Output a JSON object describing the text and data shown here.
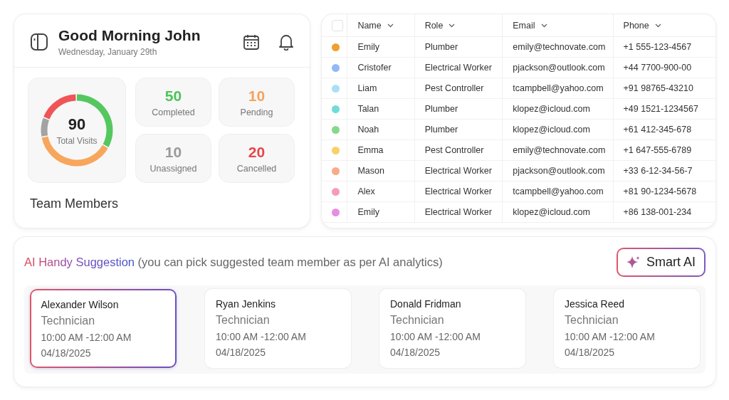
{
  "header": {
    "greeting": "Good Morning John",
    "date": "Wednesday, January 29th"
  },
  "total": {
    "value": "90",
    "label": "Total Visits"
  },
  "stats": [
    {
      "value": "50",
      "label": "Completed",
      "color": "#4cc35a"
    },
    {
      "value": "10",
      "label": "Pending",
      "color": "#f5a35c"
    },
    {
      "value": "10",
      "label": "Unassigned",
      "color": "#9a9a9a"
    },
    {
      "value": "20",
      "label": "Cancelled",
      "color": "#e5484d"
    }
  ],
  "section_title": "Team Members",
  "table": {
    "select_all_checked": false,
    "columns": [
      "Name",
      "Role",
      "Email",
      "Phone"
    ],
    "rows": [
      {
        "color": "#f0a030",
        "cells": [
          "Emily",
          "Plumber",
          "emily@technovate.com",
          "+1 555-123-4567"
        ]
      },
      {
        "color": "#93b8f5",
        "cells": [
          "Cristofer",
          "Electrical Worker",
          "pjackson@outlook.com",
          "+44 7700-900-00"
        ]
      },
      {
        "color": "#a8e0f5",
        "cells": [
          "Liam",
          "Pest Controller",
          "tcampbell@yahoo.com",
          "+91 98765-43210"
        ]
      },
      {
        "color": "#6fdcd8",
        "cells": [
          "Talan",
          "Plumber",
          "klopez@icloud.com",
          "+49 1521-1234567"
        ]
      },
      {
        "color": "#88d88a",
        "cells": [
          "Noah",
          "Plumber",
          "klopez@icloud.com",
          "+61 412-345-678"
        ]
      },
      {
        "color": "#fbd06a",
        "cells": [
          "Emma",
          "Pest Controller",
          "emily@technovate.com",
          "+1 647-555-6789"
        ]
      },
      {
        "color": "#f9ab88",
        "cells": [
          "Mason",
          "Electrical Worker",
          "pjackson@outlook.com",
          "+33 6-12-34-56-7"
        ]
      },
      {
        "color": "#f59cbd",
        "cells": [
          "Alex",
          "Electrical Worker",
          "tcampbell@yahoo.com",
          "+81 90-1234-5678"
        ]
      },
      {
        "color": "#e98de0",
        "cells": [
          "Emily",
          "Electrical Worker",
          "klopez@icloud.com",
          "+86 138-001-234"
        ]
      }
    ]
  },
  "suggestion": {
    "title": "AI Handy Suggestion",
    "note": "(you can pick suggested team member as per AI analytics)",
    "button": "Smart AI",
    "members": [
      {
        "name": "Alexander Wilson",
        "role": "Technician",
        "time": "10:00 AM -12:00 AM",
        "date": "04/18/2025",
        "selected": true
      },
      {
        "name": "Ryan Jenkins",
        "role": "Technician",
        "time": "10:00 AM -12:00 AM",
        "date": "04/18/2025",
        "selected": false
      },
      {
        "name": "Donald Fridman",
        "role": "Technician",
        "time": "10:00 AM -12:00 AM",
        "date": "04/18/2025",
        "selected": false
      },
      {
        "name": "Jessica Reed",
        "role": "Technician",
        "time": "10:00 AM -12:00 AM",
        "date": "04/18/2025",
        "selected": false
      }
    ]
  }
}
